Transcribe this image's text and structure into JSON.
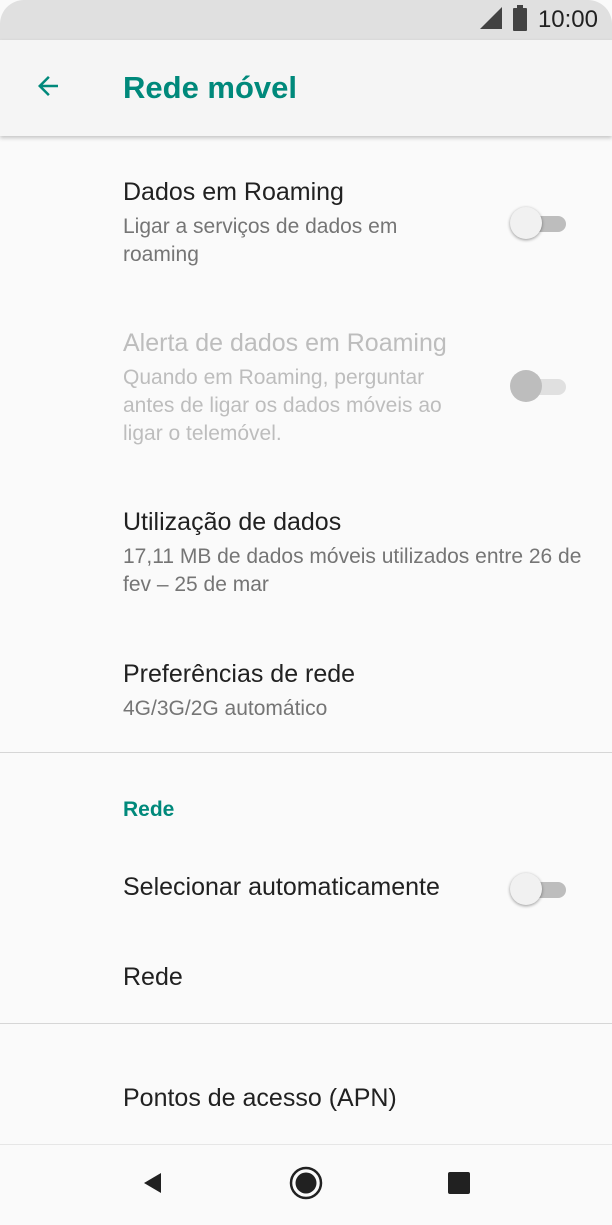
{
  "status_bar": {
    "time": "10:00",
    "icons": [
      "signal-icon",
      "battery-icon"
    ]
  },
  "app_bar": {
    "title": "Rede móvel",
    "back_icon": "arrow-back-icon"
  },
  "colors": {
    "accent": "#00897b",
    "background": "#fafafa",
    "status_bar": "#e0e0e0"
  },
  "preferences": [
    {
      "title": "Dados em Roaming",
      "summary": "Ligar a serviços de dados em roaming",
      "switch": "off",
      "enabled": true
    },
    {
      "title": "Alerta de dados em Roaming",
      "summary": "Quando em Roaming, perguntar antes de ligar os dados móveis ao ligar o telemóvel.",
      "switch": "off",
      "enabled": false
    },
    {
      "title": "Utilização de dados",
      "summary": "17,11 MB de dados móveis utilizados entre 26 de fev – 25 de mar"
    },
    {
      "title": "Preferências de rede",
      "summary": "4G/3G/2G automático"
    }
  ],
  "network_section": {
    "header": "Rede",
    "items": [
      {
        "title": "Selecionar automaticamente",
        "switch": "off"
      },
      {
        "title": "Rede"
      }
    ]
  },
  "apn": {
    "title": "Pontos de acesso (APN)"
  },
  "nav_bar": {
    "buttons": [
      "back-triangle-icon",
      "home-circle-icon",
      "recents-square-icon"
    ]
  }
}
